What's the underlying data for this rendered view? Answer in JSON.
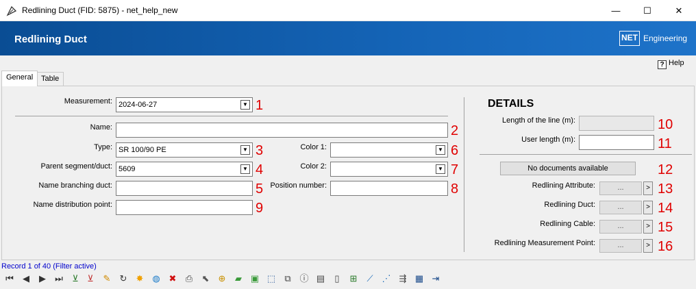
{
  "window": {
    "title": "Redlining Duct (FID: 5875) - net_help_new",
    "minimize": "—",
    "maximize": "☐",
    "close": "✕"
  },
  "header": {
    "title": "Redlining Duct",
    "brand_box": "NET",
    "brand_text": "Engineering"
  },
  "help": {
    "icon": "?",
    "label": "Help"
  },
  "tabs": [
    {
      "label": "General",
      "active": true
    },
    {
      "label": "Table",
      "active": false
    }
  ],
  "form": {
    "measurement": {
      "label": "Measurement:",
      "value": "2024-06-27",
      "num": "1"
    },
    "name": {
      "label": "Name:",
      "value": "",
      "num": "2"
    },
    "type": {
      "label": "Type:",
      "value": "SR 100/90 PE",
      "num": "3"
    },
    "parent": {
      "label": "Parent segment/duct:",
      "value": "5609",
      "num": "4"
    },
    "branching": {
      "label": "Name branching duct:",
      "value": "",
      "num": "5"
    },
    "color1": {
      "label": "Color 1:",
      "value": "",
      "num": "6"
    },
    "color2": {
      "label": "Color 2:",
      "value": "",
      "num": "7"
    },
    "position": {
      "label": "Position number:",
      "value": "",
      "num": "8"
    },
    "distribution": {
      "label": "Name distribution point:",
      "value": "",
      "num": "9"
    }
  },
  "details": {
    "title": "DETAILS",
    "length": {
      "label": "Length of the line (m):",
      "value": "",
      "num": "10"
    },
    "user_length": {
      "label": "User length (m):",
      "value": "",
      "num": "11"
    },
    "documents": {
      "label": "No documents available",
      "num": "12"
    },
    "links": [
      {
        "label": "Redlining Attribute:",
        "button": "...",
        "arrow": ">",
        "num": "13"
      },
      {
        "label": "Redlining Duct:",
        "button": "...",
        "arrow": ">",
        "num": "14"
      },
      {
        "label": "Redlining Cable:",
        "button": "...",
        "arrow": ">",
        "num": "15"
      },
      {
        "label": "Redlining Measurement Point:",
        "button": "...",
        "arrow": ">",
        "num": "16"
      }
    ]
  },
  "status": {
    "record_text": "Record 1 of 40 (Filter active)"
  },
  "toolbar": {
    "icons": [
      {
        "name": "first-record-icon",
        "glyph": "⏮",
        "color": "#333333"
      },
      {
        "name": "previous-record-icon",
        "glyph": "◀",
        "color": "#333333"
      },
      {
        "name": "next-record-icon",
        "glyph": "▶",
        "color": "#333333"
      },
      {
        "name": "last-record-icon",
        "glyph": "⏭",
        "color": "#333333"
      },
      {
        "name": "add-filter-icon",
        "glyph": "⊻",
        "color": "#2a7a2a"
      },
      {
        "name": "remove-filter-icon",
        "glyph": "⊻",
        "color": "#c03030"
      },
      {
        "name": "edit-icon",
        "glyph": "✎",
        "color": "#d08a00"
      },
      {
        "name": "refresh-icon",
        "glyph": "↻",
        "color": "#333333"
      },
      {
        "name": "highlight-icon",
        "glyph": "✸",
        "color": "#f0a000"
      },
      {
        "name": "globe-refresh-icon",
        "glyph": "◍",
        "color": "#1a7ac8"
      },
      {
        "name": "delete-icon",
        "glyph": "✖",
        "color": "#d01010"
      },
      {
        "name": "print-icon",
        "glyph": "⎙",
        "color": "#444444"
      },
      {
        "name": "select-cursor-icon",
        "glyph": "⬉",
        "color": "#555555"
      },
      {
        "name": "zoom-icon",
        "glyph": "⊕",
        "color": "#c89000"
      },
      {
        "name": "shape-green-icon",
        "glyph": "▰",
        "color": "#3a9a3a"
      },
      {
        "name": "shape-green-double-icon",
        "glyph": "▣",
        "color": "#3a9a3a"
      },
      {
        "name": "dashed-select-icon",
        "glyph": "⬚",
        "color": "#2a5a9a"
      },
      {
        "name": "copy-shape-icon",
        "glyph": "⧉",
        "color": "#444444"
      },
      {
        "name": "info-icon",
        "glyph": "ⓘ",
        "color": "#444444"
      },
      {
        "name": "report-icon",
        "glyph": "▤",
        "color": "#444444"
      },
      {
        "name": "document-icon",
        "glyph": "▯",
        "color": "#444444"
      },
      {
        "name": "add-document-icon",
        "glyph": "⊞",
        "color": "#2a7a2a"
      },
      {
        "name": "line-tool-icon",
        "glyph": "⟋",
        "color": "#1a6ab8"
      },
      {
        "name": "dashed-line-icon",
        "glyph": "⋰",
        "color": "#1a6ab8"
      },
      {
        "name": "split-icon",
        "glyph": "⇶",
        "color": "#444444"
      },
      {
        "name": "table-edit-icon",
        "glyph": "▦",
        "color": "#1a4a8a"
      },
      {
        "name": "exit-icon",
        "glyph": "⇥",
        "color": "#1a4a8a"
      }
    ]
  }
}
